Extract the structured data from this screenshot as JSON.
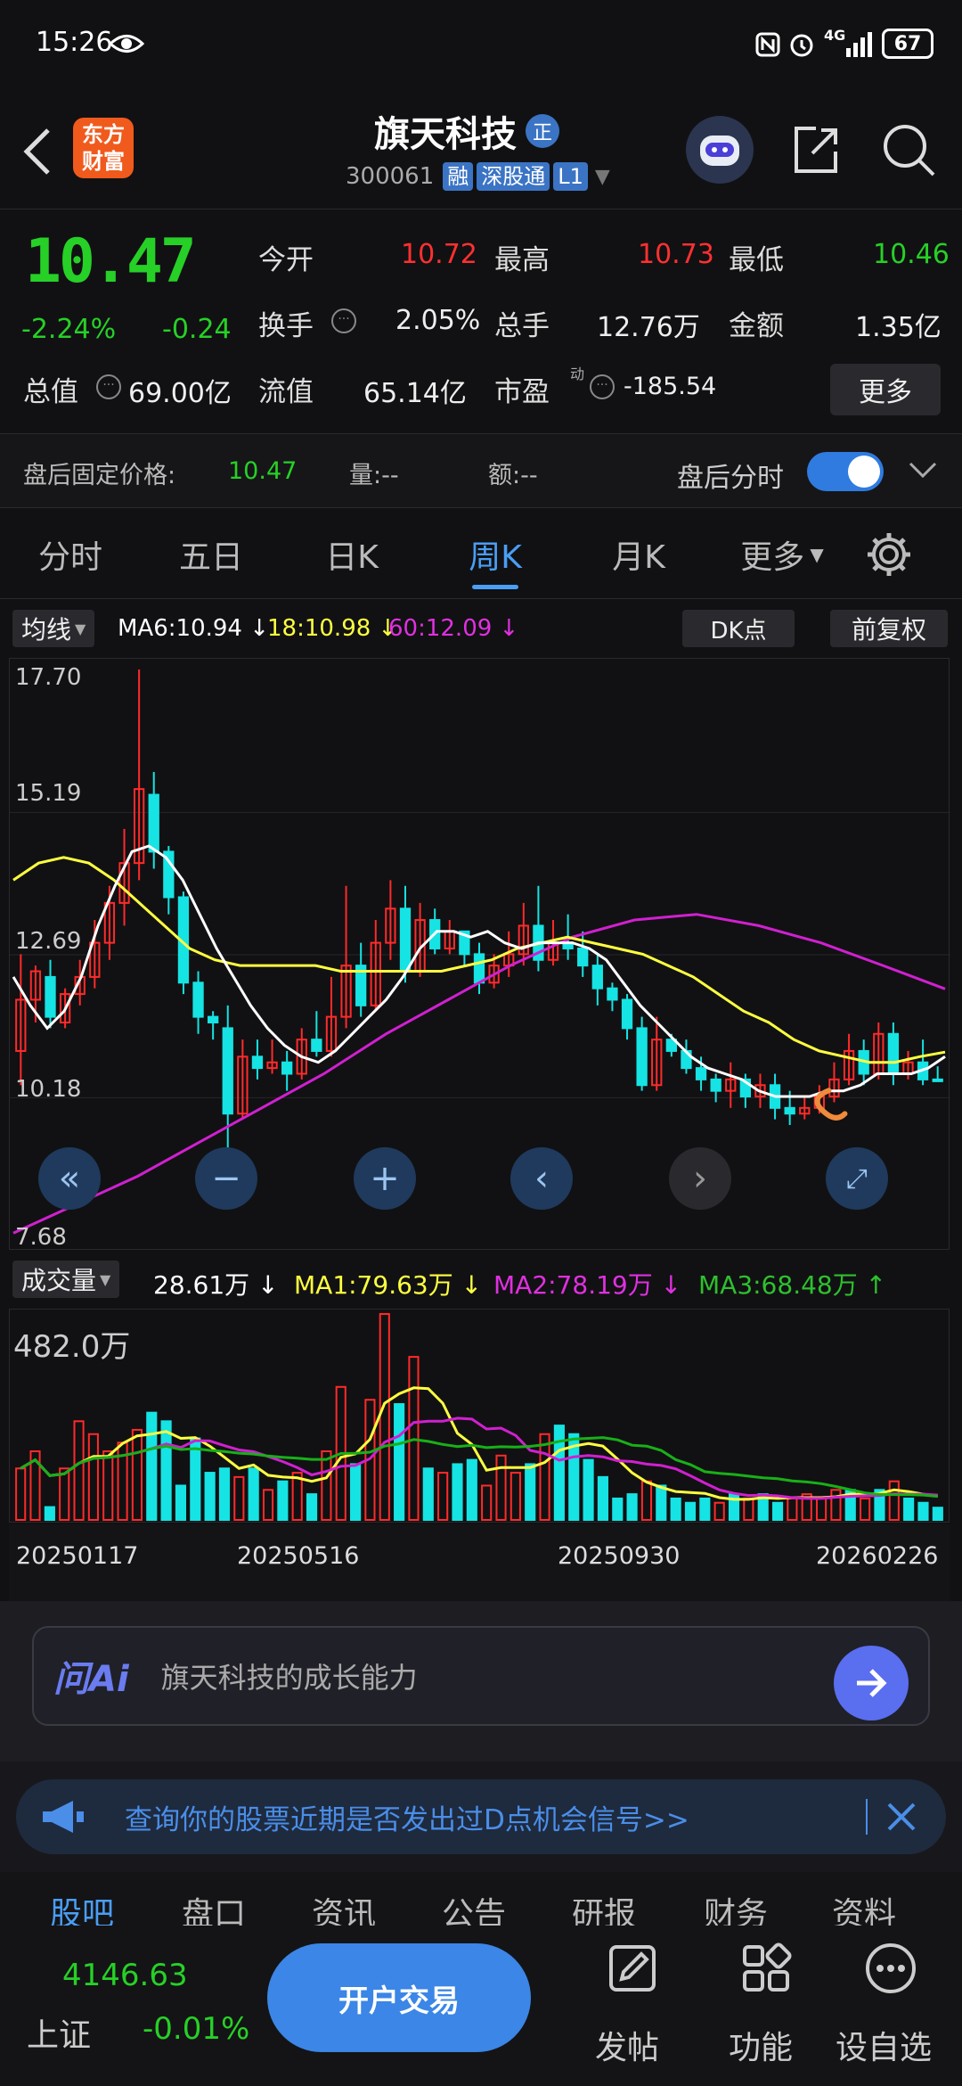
{
  "status": {
    "time": "15:26",
    "battery": "67",
    "net": "4G"
  },
  "header": {
    "name": "旗天科技",
    "badge": "正",
    "code": "300061",
    "tags": [
      "融",
      "深股通",
      "L1"
    ],
    "logo": "东方\n财富"
  },
  "quote": {
    "price": "10.47",
    "pct": "-2.24%",
    "chg": "-0.24",
    "row1": [
      {
        "l": "今开",
        "v": "10.72",
        "c": "red"
      },
      {
        "l": "最高",
        "v": "10.73",
        "c": "red"
      },
      {
        "l": "最低",
        "v": "10.46",
        "c": "green"
      }
    ],
    "row2": [
      {
        "l": "换手",
        "v": "2.05%"
      },
      {
        "l": "总手",
        "v": "12.76万"
      },
      {
        "l": "金额",
        "v": "1.35亿"
      }
    ],
    "row3": [
      {
        "l": "总值",
        "v": "69.00亿"
      },
      {
        "l": "流值",
        "v": "65.14亿"
      },
      {
        "l": "市盈",
        "sup": "动",
        "v": "-185.54"
      }
    ],
    "more": "更多"
  },
  "after": {
    "label": "盘后固定价格:",
    "price": "10.47",
    "vol": "量:--",
    "amt": "额:--",
    "toggle": "盘后分时"
  },
  "tabs": [
    "分时",
    "五日",
    "日K",
    "周K",
    "月K",
    "更多"
  ],
  "active_tab": "周K",
  "chart_legend": {
    "avg": "均线",
    "ma6": "MA6:10.94",
    "ma18": "18:10.98",
    "ma60": "60:12.09",
    "dk": "DK点",
    "fq": "前复权"
  },
  "yaxis": [
    "17.70",
    "15.19",
    "12.69",
    "10.18",
    "7.68"
  ],
  "vol_legend": {
    "label": "成交量",
    "v": "28.61万",
    "ma1": "MA1:79.63万",
    "ma2": "MA2:78.19万",
    "ma3": "MA3:68.48万",
    "max": "482.0万"
  },
  "dates": [
    "20250117",
    "20250516",
    "20250930",
    "20260226"
  ],
  "colors": {
    "up": "#ff2a2a",
    "down": "#16e3e3",
    "ma6": "#ffffff",
    "ma18": "#ffff40",
    "ma60": "#d020d0",
    "vma3": "#18b018"
  },
  "ai": {
    "brand": "问Ai",
    "text": "旗天科技的成长能力"
  },
  "notice": "查询你的股票近期是否发出过D点机会信号>>",
  "bottom_tabs": [
    "股吧",
    "盘口",
    "资讯",
    "公告",
    "研报",
    "财务",
    "资料"
  ],
  "index": {
    "value": "4146.63",
    "name": "上证",
    "pct": "-0.01%"
  },
  "trade": "开户交易",
  "actions": [
    "发帖",
    "功能",
    "设自选"
  ],
  "chart_data": {
    "type": "candlestick",
    "ylim": [
      7.68,
      17.7
    ],
    "candles": [
      [
        11.0,
        11.9,
        10.4,
        12.7
      ],
      [
        11.9,
        12.4,
        11.5,
        12.5
      ],
      [
        12.3,
        11.6,
        11.4,
        12.6
      ],
      [
        11.5,
        12.0,
        11.4,
        12.1
      ],
      [
        12.0,
        12.3,
        11.8,
        12.6
      ],
      [
        12.3,
        12.9,
        12.1,
        13.3
      ],
      [
        12.9,
        13.6,
        12.6,
        13.9
      ],
      [
        13.6,
        14.3,
        13.2,
        14.9
      ],
      [
        14.3,
        15.6,
        14.0,
        17.7
      ],
      [
        15.5,
        14.5,
        14.2,
        15.9
      ],
      [
        14.5,
        13.7,
        13.4,
        14.6
      ],
      [
        13.7,
        12.2,
        12.0,
        13.8
      ],
      [
        12.2,
        11.6,
        11.3,
        12.4
      ],
      [
        11.6,
        11.5,
        11.2,
        11.7
      ],
      [
        11.4,
        9.9,
        8.3,
        11.8
      ],
      [
        9.9,
        10.9,
        9.8,
        11.2
      ],
      [
        10.9,
        10.7,
        10.5,
        11.2
      ],
      [
        10.7,
        10.8,
        10.6,
        11.2
      ],
      [
        10.8,
        10.6,
        10.3,
        11.0
      ],
      [
        10.6,
        11.2,
        10.5,
        11.4
      ],
      [
        11.2,
        11.0,
        10.9,
        11.7
      ],
      [
        11.0,
        11.6,
        10.9,
        12.3
      ],
      [
        11.6,
        12.5,
        11.4,
        13.9
      ],
      [
        12.5,
        11.8,
        11.6,
        12.9
      ],
      [
        11.8,
        12.9,
        11.7,
        13.3
      ],
      [
        12.9,
        13.5,
        12.6,
        14.0
      ],
      [
        13.5,
        12.4,
        12.2,
        13.9
      ],
      [
        12.4,
        13.3,
        12.3,
        13.6
      ],
      [
        13.3,
        12.8,
        12.7,
        13.5
      ],
      [
        12.8,
        13.1,
        12.7,
        13.3
      ],
      [
        13.1,
        12.7,
        12.5,
        13.1
      ],
      [
        12.7,
        12.2,
        12.0,
        12.9
      ],
      [
        12.2,
        12.5,
        12.1,
        12.7
      ],
      [
        12.5,
        12.7,
        12.3,
        13.1
      ],
      [
        12.7,
        13.2,
        12.5,
        13.6
      ],
      [
        13.2,
        12.6,
        12.4,
        13.9
      ],
      [
        12.6,
        12.9,
        12.5,
        13.3
      ],
      [
        12.9,
        12.8,
        12.6,
        13.4
      ],
      [
        12.8,
        12.5,
        12.3,
        13.1
      ],
      [
        12.5,
        12.1,
        11.8,
        12.7
      ],
      [
        12.1,
        11.9,
        11.7,
        12.2
      ],
      [
        11.9,
        11.4,
        11.2,
        12.0
      ],
      [
        11.4,
        10.4,
        10.3,
        11.6
      ],
      [
        10.4,
        11.2,
        10.3,
        11.6
      ],
      [
        11.2,
        11.0,
        10.9,
        11.3
      ],
      [
        11.0,
        10.7,
        10.6,
        11.2
      ],
      [
        10.7,
        10.5,
        10.3,
        10.9
      ],
      [
        10.5,
        10.3,
        10.1,
        10.6
      ],
      [
        10.3,
        10.5,
        10.0,
        10.8
      ],
      [
        10.5,
        10.2,
        10.0,
        10.6
      ],
      [
        10.2,
        10.4,
        10.0,
        10.6
      ],
      [
        10.4,
        10.0,
        9.8,
        10.6
      ],
      [
        10.0,
        9.9,
        9.7,
        10.3
      ],
      [
        9.9,
        10.0,
        9.8,
        10.2
      ],
      [
        10.0,
        10.2,
        9.9,
        10.4
      ],
      [
        10.2,
        10.5,
        10.1,
        10.8
      ],
      [
        10.5,
        11.0,
        10.4,
        11.3
      ],
      [
        11.0,
        10.6,
        10.4,
        11.2
      ],
      [
        10.6,
        11.3,
        10.5,
        11.5
      ],
      [
        11.3,
        10.6,
        10.4,
        11.5
      ],
      [
        10.6,
        10.8,
        10.5,
        11.0
      ],
      [
        10.8,
        10.5,
        10.4,
        11.2
      ],
      [
        10.5,
        10.47,
        10.46,
        10.73
      ]
    ],
    "ma6": [
      12.3,
      11.8,
      11.4,
      11.7,
      12.3,
      13.2,
      13.9,
      14.5,
      14.6,
      14.4,
      14.0,
      13.4,
      12.8,
      12.3,
      11.8,
      11.4,
      11.1,
      10.9,
      10.8,
      11.0,
      11.3,
      11.6,
      11.9,
      12.3,
      12.8,
      13.1,
      13.1,
      13.0,
      13.1,
      12.9,
      12.8,
      12.9,
      12.9,
      12.9,
      12.8,
      12.6,
      12.2,
      11.8,
      11.5,
      11.2,
      10.9,
      10.7,
      10.6,
      10.5,
      10.3,
      10.2,
      10.2,
      10.2,
      10.3,
      10.3,
      10.4,
      10.6,
      10.6,
      10.6,
      10.7,
      10.9
    ],
    "ma18": [
      14.0,
      14.3,
      14.4,
      14.3,
      14.0,
      13.6,
      13.2,
      12.8,
      12.6,
      12.5,
      12.5,
      12.5,
      12.5,
      12.4,
      12.4,
      12.4,
      12.4,
      12.4,
      12.5,
      12.6,
      12.8,
      12.9,
      13.0,
      12.9,
      12.8,
      12.7,
      12.5,
      12.3,
      12.0,
      11.7,
      11.5,
      11.2,
      11.0,
      10.9,
      10.8,
      10.8,
      10.9,
      10.98
    ],
    "ma60": [
      7.8,
      8.3,
      8.8,
      9.4,
      10.0,
      10.6,
      11.3,
      11.9,
      12.5,
      13.0,
      13.3,
      13.4,
      13.2,
      12.9,
      12.5,
      12.09
    ],
    "volumes": [
      120,
      160,
      30,
      120,
      230,
      200,
      160,
      180,
      210,
      250,
      230,
      80,
      190,
      110,
      120,
      100,
      120,
      70,
      90,
      110,
      60,
      160,
      310,
      130,
      280,
      480,
      270,
      380,
      120,
      110,
      130,
      140,
      80,
      150,
      110,
      130,
      200,
      220,
      200,
      140,
      100,
      50,
      60,
      90,
      80,
      50,
      40,
      50,
      40,
      60,
      50,
      60,
      40,
      50,
      60,
      50,
      70,
      70,
      50,
      70,
      90,
      50,
      40,
      28.61
    ]
  }
}
